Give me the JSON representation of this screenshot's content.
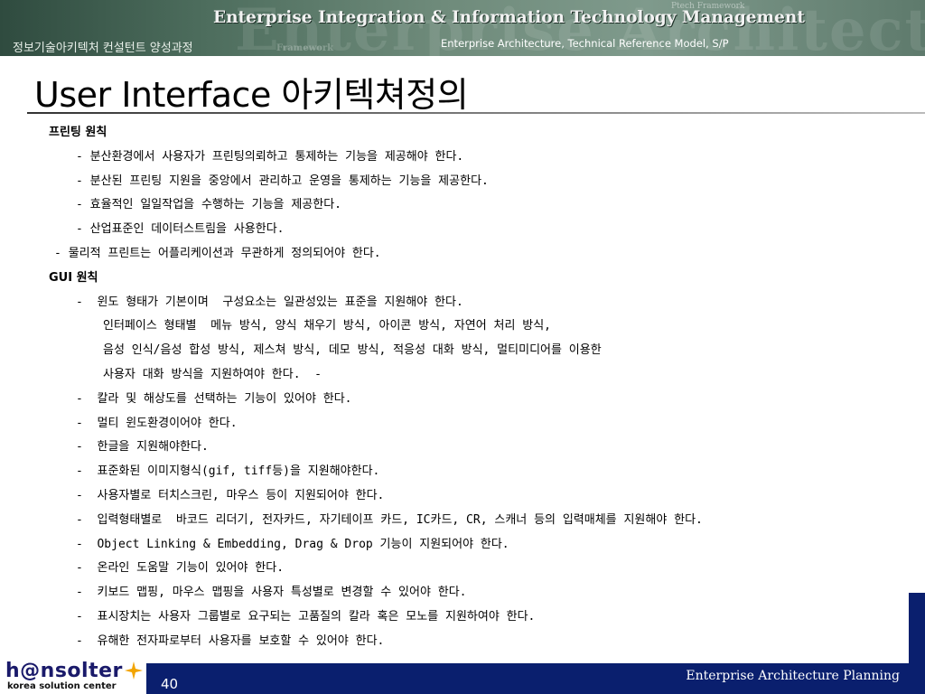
{
  "header": {
    "title": "Enterprise Integration & Information Technology Management",
    "course": "정보기술아키텍처 컨설턴트 양성과정",
    "subtitle": "Enterprise Architecture, Technical Reference Model, S/P",
    "watermark": "Enterprise Architecture Model",
    "small_watermark": "Ptech Framework",
    "small_watermark2": "Framework"
  },
  "slide": {
    "title": "User Interface 아키텍쳐정의"
  },
  "content": {
    "lines": [
      {
        "indent": 54,
        "heading": true,
        "text": "프린팅 원칙"
      },
      {
        "indent": 84,
        "heading": false,
        "text": "- 분산환경에서 사용자가 프린팅의뢰하고 통제하는 기능을 제공해야 한다."
      },
      {
        "indent": 84,
        "heading": false,
        "text": "- 분산된 프린팅 지원을 중앙에서 관리하고 운영을 통제하는 기능을 제공한다."
      },
      {
        "indent": 84,
        "heading": false,
        "text": "- 효율적인 일일작업을 수행하는 기능을 제공한다."
      },
      {
        "indent": 84,
        "heading": false,
        "text": "- 산업표준인 데이터스트림을 사용한다."
      },
      {
        "indent": 60,
        "heading": false,
        "text": "- 물리적 프린트는 어플리케이션과 무관하게 정의되어야 한다."
      },
      {
        "indent": 54,
        "heading": true,
        "text": "GUI 원칙"
      },
      {
        "indent": 84,
        "heading": false,
        "text": "-  윈도 형태가 기본이며  구성요소는 일관성있는 표준을 지원해야 한다."
      },
      {
        "indent": 114,
        "heading": false,
        "text": "인터페이스 형태별  메뉴 방식, 양식 채우기 방식, 아이콘 방식, 자연어 처리 방식,"
      },
      {
        "indent": 114,
        "heading": false,
        "text": "음성 인식/음성 합성 방식, 제스쳐 방식, 데모 방식, 적응성 대화 방식, 멀티미디어를 이용한"
      },
      {
        "indent": 114,
        "heading": false,
        "text": "사용자 대화 방식을 지원하여야 한다.  -"
      },
      {
        "indent": 84,
        "heading": false,
        "text": "-  칼라 및 해상도를 선택하는 기능이 있어야 한다."
      },
      {
        "indent": 84,
        "heading": false,
        "text": "-  멀티 윈도환경이어야 한다."
      },
      {
        "indent": 84,
        "heading": false,
        "text": "-  한글을 지원해야한다."
      },
      {
        "indent": 84,
        "heading": false,
        "text": "-  표준화된 이미지형식(gif, tiff등)을 지원해야한다."
      },
      {
        "indent": 84,
        "heading": false,
        "text": "-  사용자별로 터치스크린, 마우스 등이 지원되어야 한다."
      },
      {
        "indent": 84,
        "heading": false,
        "text": "-  입력형태별로  바코드 리더기, 전자카드, 자기테이프 카드, IC카드, CR, 스캐너 등의 입력매체를 지원해야 한다."
      },
      {
        "indent": 84,
        "heading": false,
        "text": "-  Object Linking & Embedding, Drag & Drop 기능이 지원되어야 한다."
      },
      {
        "indent": 84,
        "heading": false,
        "text": "-  온라인 도움말 기능이 있어야 한다."
      },
      {
        "indent": 84,
        "heading": false,
        "text": "-  키보드 맵핑, 마우스 맵핑을 사용자 특성별로 변경할 수 있어야 한다."
      },
      {
        "indent": 84,
        "heading": false,
        "text": "-  표시장치는 사용자 그룹별로 요구되는 고품질의 칼라 혹은 모노를 지원하여야 한다."
      },
      {
        "indent": 84,
        "heading": false,
        "text": "-  유해한 전자파로부터 사용자를 보호할 수 있어야 한다."
      }
    ]
  },
  "footer": {
    "page_number": "40",
    "text": "Enterprise Architecture Planning",
    "logo_main": "h@nsolter",
    "logo_sub": "korea solution center"
  },
  "colors": {
    "navy": "#0a1f6e",
    "banner": "#4d6d5d"
  }
}
